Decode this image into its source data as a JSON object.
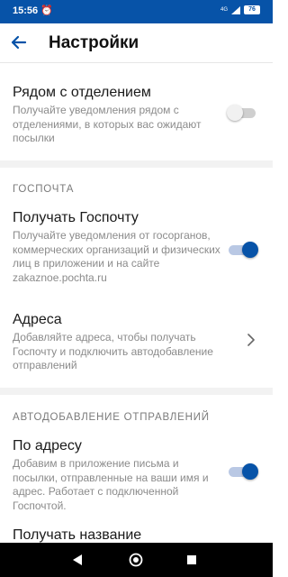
{
  "status_bar": {
    "time": "15:56",
    "network": "4G",
    "battery": "76"
  },
  "header": {
    "title": "Настройки"
  },
  "items": [
    {
      "title": "Рядом с отделением",
      "description": "Получайте уведомления рядом с отделениями, в которых вас ожидают посылки",
      "enabled": false
    }
  ],
  "sections": [
    {
      "header": "ГОСПОЧТА",
      "items": [
        {
          "title": "Получать Госпочту",
          "description": "Получайте уведомления от госорганов, коммерческих организаций и физических лиц в приложении и на сайте zakaznoe.pochta.ru",
          "enabled": true
        },
        {
          "title": "Адреса",
          "description": "Добавляйте адреса, чтобы получать Госпочту и подключить автодобавление отправлений"
        }
      ]
    },
    {
      "header": "АВТОДОБАВЛЕНИЕ ОТПРАВЛЕНИЙ",
      "items": [
        {
          "title": "По адресу",
          "description": "Добавим в приложение письма и посылки, отправленные на ваши имя и адрес. Работает с подключенной Госпочтой.",
          "enabled": true
        },
        {
          "title": "Получать название"
        }
      ]
    }
  ],
  "colors": {
    "accent": "#0753a8",
    "divider": "#f2f2f2",
    "secondary_text": "#8b8b8b"
  },
  "icons": {
    "back": "arrow-left-icon",
    "chevron": "chevron-right-icon",
    "alarm": "alarm-clock-icon",
    "nav_back": "triangle-back-icon",
    "nav_home": "circle-home-icon",
    "nav_recent": "square-recent-icon"
  }
}
